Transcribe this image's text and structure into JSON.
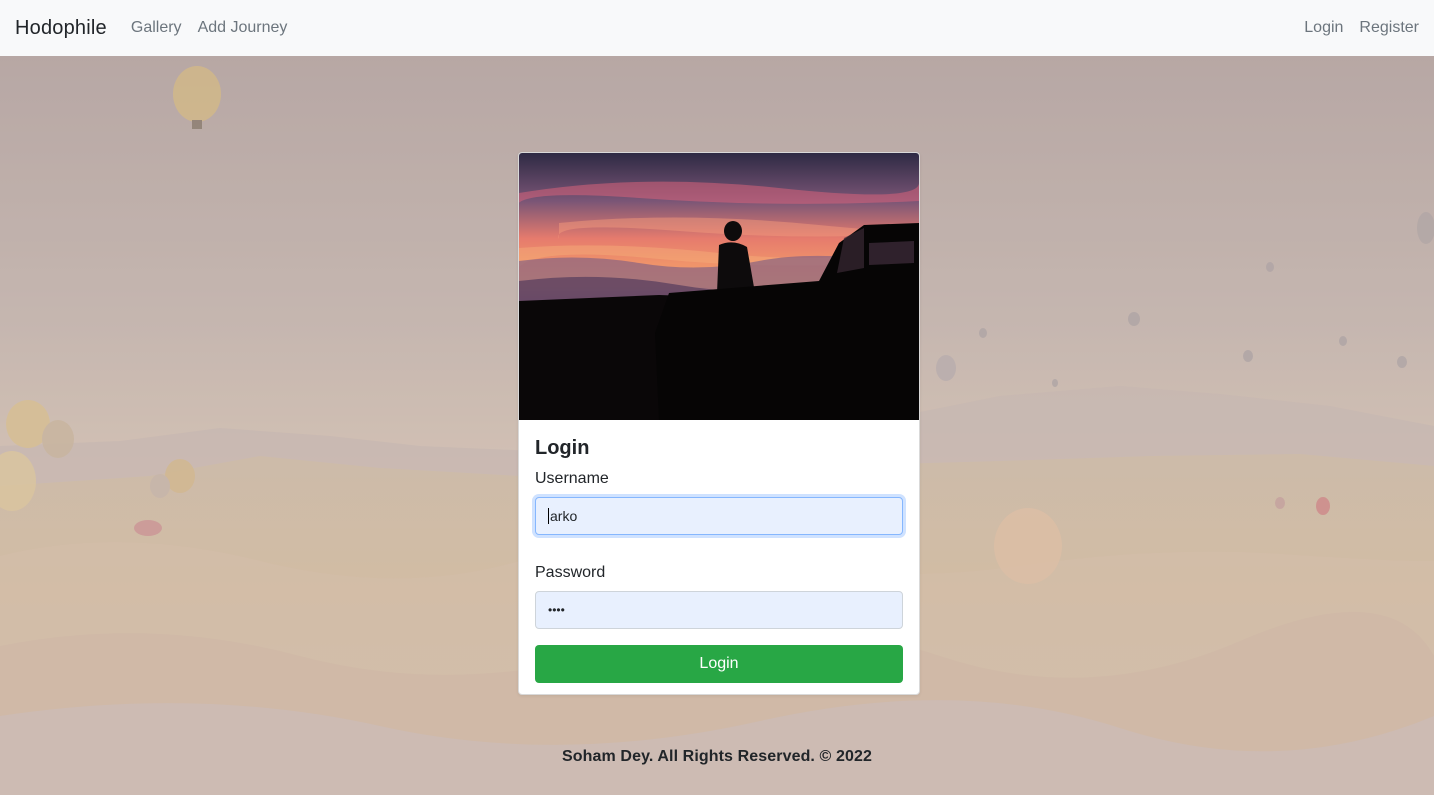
{
  "navbar": {
    "brand": "Hodophile",
    "links": [
      "Gallery",
      "Add Journey"
    ],
    "right_links": [
      "Login",
      "Register"
    ]
  },
  "login_card": {
    "image": "sunset-silhouette-with-jeep",
    "title": "Login",
    "username": {
      "label": "Username",
      "value": "arko"
    },
    "password": {
      "label": "Password",
      "value": "••••"
    },
    "submit_label": "Login"
  },
  "footer": {
    "text": "Soham Dey. All Rights Reserved. © 2022"
  },
  "background": {
    "image": "hot-air-balloons-over-valley"
  },
  "colors": {
    "navbar_bg": "#f8f9fa",
    "button_green": "#28a745",
    "autofill_bg": "#e8f0fe",
    "focus_border": "#86b7fe"
  }
}
